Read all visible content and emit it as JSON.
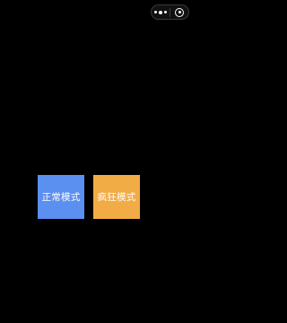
{
  "capsule": {
    "more_icon": "more-dots-icon",
    "close_icon": "target-circle-icon"
  },
  "modes": {
    "normal_label": "正常模式",
    "crazy_label": "疯狂模式"
  },
  "colors": {
    "background": "#000000",
    "normal_mode": "#5b8ff0",
    "crazy_mode": "#f2ac45",
    "text": "#ffffff"
  }
}
